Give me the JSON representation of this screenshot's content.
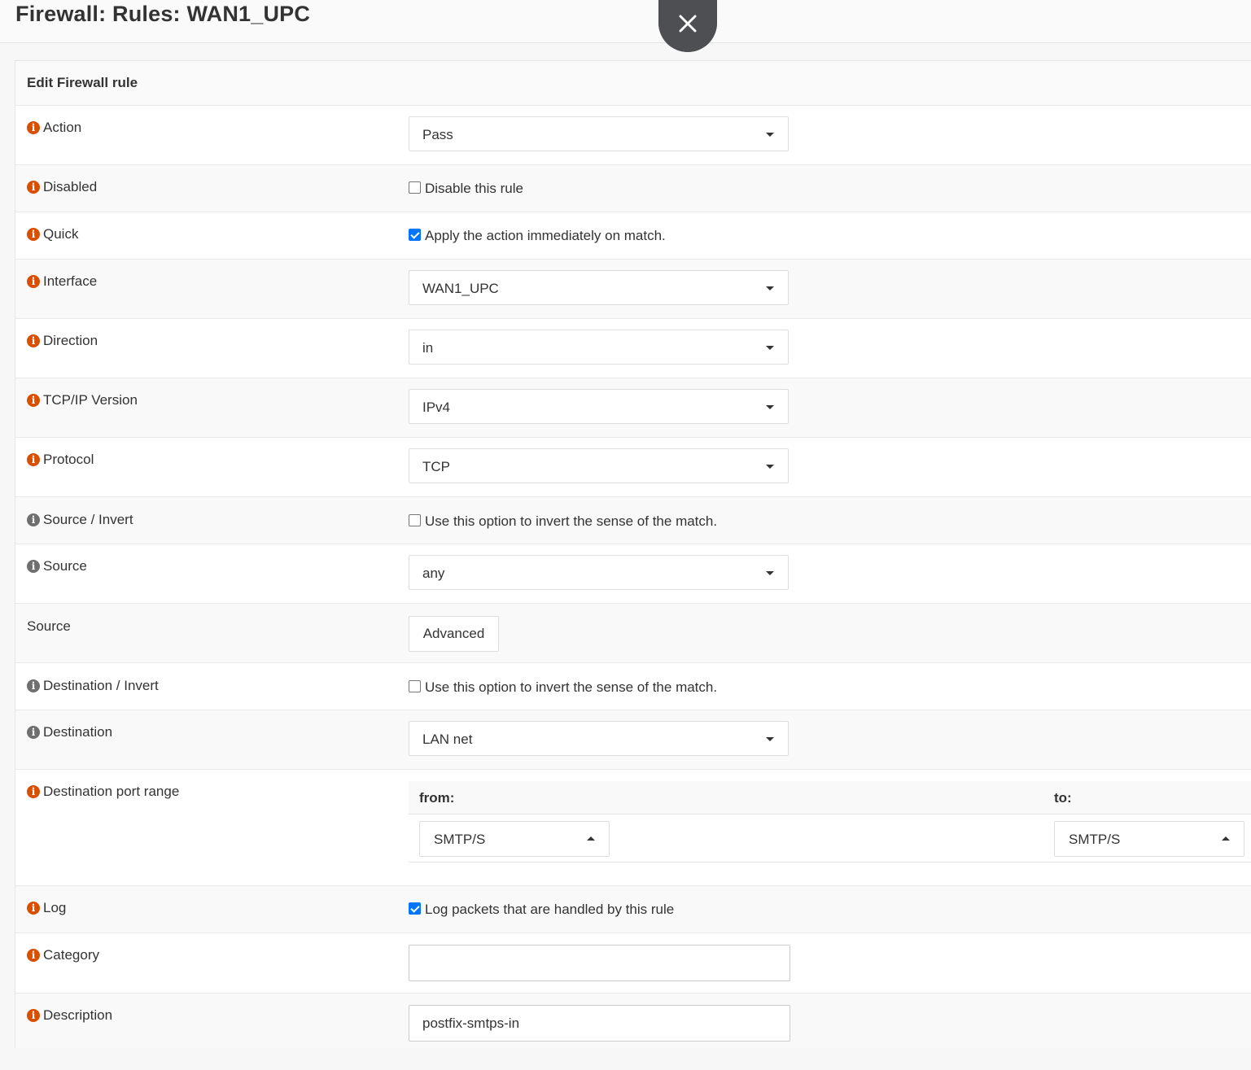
{
  "page": {
    "title": "Firewall: Rules: WAN1_UPC"
  },
  "panel": {
    "title": "Edit Firewall rule"
  },
  "fields": {
    "action": {
      "label": "Action",
      "value": "Pass"
    },
    "disabled": {
      "label": "Disabled",
      "checkbox_label": "Disable this rule",
      "checked": false
    },
    "quick": {
      "label": "Quick",
      "checkbox_label": "Apply the action immediately on match.",
      "checked": true
    },
    "interface": {
      "label": "Interface",
      "value": "WAN1_UPC"
    },
    "direction": {
      "label": "Direction",
      "value": "in"
    },
    "ip_version": {
      "label": "TCP/IP Version",
      "value": "IPv4"
    },
    "protocol": {
      "label": "Protocol",
      "value": "TCP"
    },
    "source_invert": {
      "label": "Source / Invert",
      "checkbox_label": "Use this option to invert the sense of the match.",
      "checked": false
    },
    "source": {
      "label": "Source",
      "value": "any"
    },
    "source_advanced": {
      "label": "Source",
      "button_label": "Advanced"
    },
    "destination_invert": {
      "label": "Destination / Invert",
      "checkbox_label": "Use this option to invert the sense of the match.",
      "checked": false
    },
    "destination": {
      "label": "Destination",
      "value": "LAN net"
    },
    "dest_port_range": {
      "label": "Destination port range",
      "from_label": "from:",
      "to_label": "to:",
      "from_value": "SMTP/S",
      "to_value": "SMTP/S"
    },
    "log": {
      "label": "Log",
      "checkbox_label": "Log packets that are handled by this rule",
      "checked": true
    },
    "category": {
      "label": "Category",
      "value": ""
    },
    "description": {
      "label": "Description",
      "value": "postfix-smtps-in"
    }
  },
  "icons": {
    "info": "info-icon",
    "close": "close-icon",
    "caret": "caret-down-icon"
  },
  "colors": {
    "info_orange": "#d94f00",
    "info_grey": "#6f6f6f",
    "checkbox_checked": "#0075ff",
    "close_button": "#4d4f52"
  }
}
